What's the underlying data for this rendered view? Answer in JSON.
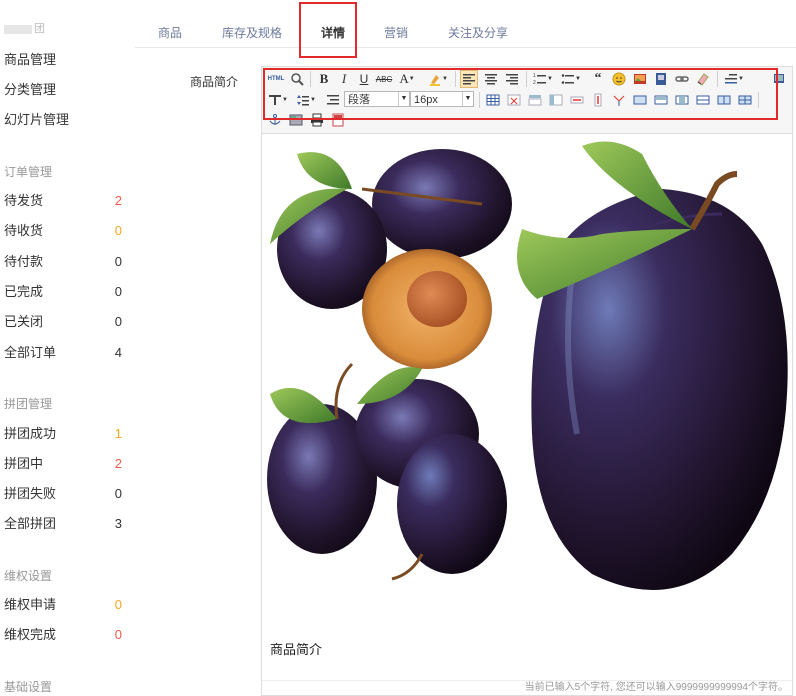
{
  "sidebar": {
    "title_suffix": "团",
    "items": [
      {
        "label": "商品管理"
      },
      {
        "label": "分类管理"
      },
      {
        "label": "幻灯片管理"
      }
    ],
    "groups": [
      {
        "title": "订单管理",
        "items": [
          {
            "label": "待发货",
            "count": "2",
            "color": "red"
          },
          {
            "label": "待收货",
            "count": "0",
            "color": "orange"
          },
          {
            "label": "待付款",
            "count": "0",
            "color": "dark"
          },
          {
            "label": "已完成",
            "count": "0",
            "color": "dark"
          },
          {
            "label": "已关闭",
            "count": "0",
            "color": "dark"
          },
          {
            "label": "全部订单",
            "count": "4",
            "color": "dark"
          }
        ]
      },
      {
        "title": "拼团管理",
        "items": [
          {
            "label": "拼团成功",
            "count": "1",
            "color": "orange"
          },
          {
            "label": "拼团中",
            "count": "2",
            "color": "red"
          },
          {
            "label": "拼团失败",
            "count": "0",
            "color": "dark"
          },
          {
            "label": "全部拼团",
            "count": "3",
            "color": "dark"
          }
        ]
      },
      {
        "title": "维权设置",
        "items": [
          {
            "label": "维权申请",
            "count": "0",
            "color": "orange"
          },
          {
            "label": "维权完成",
            "count": "0",
            "color": "red"
          }
        ]
      },
      {
        "title": "基础设置",
        "items": []
      }
    ]
  },
  "tabs": [
    {
      "label": "商品"
    },
    {
      "label": "库存及规格"
    },
    {
      "label": "详情",
      "active": true
    },
    {
      "label": "营销"
    },
    {
      "label": "关注及分享"
    }
  ],
  "form": {
    "label": "商品简介"
  },
  "editor": {
    "paragraph_select": "段落",
    "font_size_select": "16px",
    "html_button": "HTML",
    "content_text": "商品简介",
    "counter_text": "当前已输入5个字符, 您还可以输入9999999999994个字符。"
  },
  "colors": {
    "red": "#f05a4b",
    "orange": "#f5a623",
    "highlight": "#e12a2a",
    "tab_text": "#6d7a9c"
  }
}
